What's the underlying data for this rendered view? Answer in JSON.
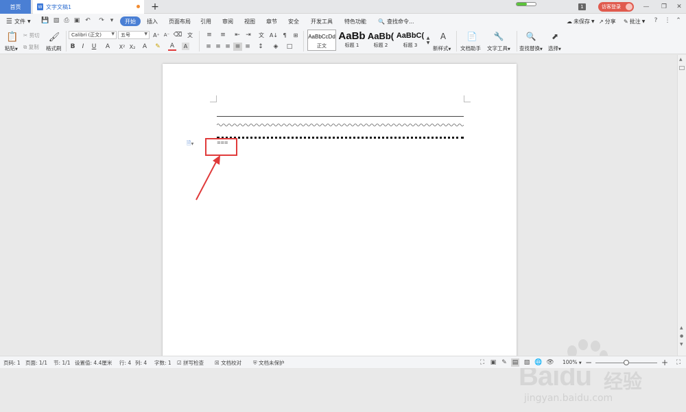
{
  "tabs": {
    "home": "首页",
    "doc_title": "文字文稿1",
    "doc_icon": "W",
    "new_tab": "+"
  },
  "titlebar": {
    "window_count": "1",
    "login": "访客登录",
    "progress": 0.55
  },
  "menu": {
    "file": "文件",
    "items": [
      "开始",
      "插入",
      "页面布局",
      "引用",
      "审阅",
      "视图",
      "章节",
      "安全",
      "开发工具",
      "特色功能"
    ],
    "search": "查找命令...",
    "unsaved": "未保存",
    "share": "分享",
    "comment": "批注"
  },
  "ribbon": {
    "paste": "粘贴",
    "cut": "剪切",
    "copy": "复制",
    "format_painter": "格式刷",
    "font_name": "Calibri (正文)",
    "font_size": "五号",
    "styles": [
      {
        "sample": "AaBbCcDd",
        "label": "正文"
      },
      {
        "sample": "AaBb",
        "label": "标题 1"
      },
      {
        "sample": "AaBb(",
        "label": "标题 2"
      },
      {
        "sample": "AaBbC(",
        "label": "标题 3"
      }
    ],
    "new_style": "新样式",
    "doc_assistant": "文档助手",
    "text_tools": "文字工具",
    "find_replace": "查找替换",
    "select": "选择"
  },
  "document": {
    "typed_text": "==="
  },
  "statusbar": {
    "page_no": "页码: 1",
    "pages": "页面: 1/1",
    "section": "节: 1/1",
    "setting": "设置值: 4.4厘米",
    "row": "行: 4",
    "col": "列: 4",
    "word_count": "字数: 1",
    "spellcheck": "拼写检查",
    "proofread": "文档校对",
    "protect": "文档未保护",
    "zoom": "100%",
    "zoom_level": 0.5
  },
  "watermark": {
    "brand": "Bai",
    "brand2": "du",
    "cn": "经验",
    "url": "jingyan.baidu.com"
  },
  "colors": {
    "accent": "#4a7fd4",
    "annotation_red": "#e03a3a",
    "login_red": "#e05a4e"
  }
}
